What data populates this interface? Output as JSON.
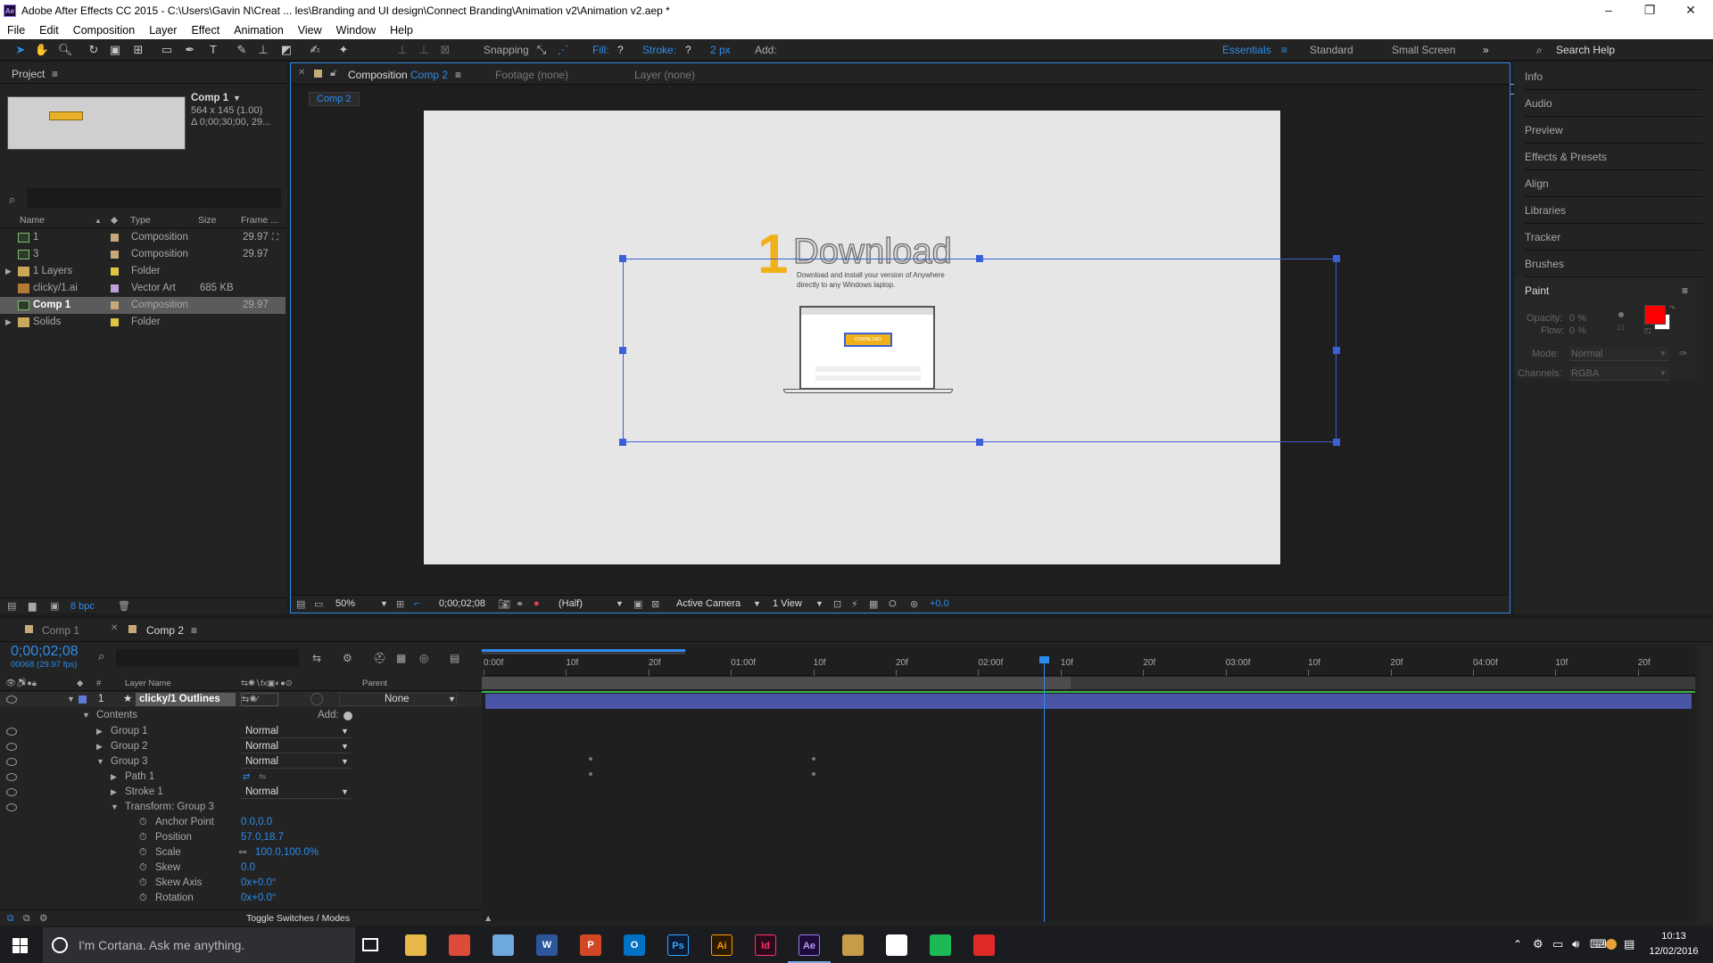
{
  "window": {
    "app_badge": "Ae",
    "title": "Adobe After Effects CC 2015 - C:\\Users\\Gavin N\\Creat ... les\\Branding and UI design\\Connect Branding\\Animation v2\\Animation v2.aep *",
    "minimize": "–",
    "maximize": "❐",
    "close": "✕"
  },
  "menu": [
    "File",
    "Edit",
    "Composition",
    "Layer",
    "Effect",
    "Animation",
    "View",
    "Window",
    "Help"
  ],
  "toolbar": {
    "snapping": "Snapping",
    "fill_label": "Fill:",
    "fill_value": "?",
    "stroke_label": "Stroke:",
    "stroke_value": "?",
    "stroke_px": "2 px",
    "add_label": "Add:",
    "workspaces": [
      "Essentials",
      "Standard",
      "Small Screen"
    ],
    "more": "»",
    "search_help": "Search Help"
  },
  "project": {
    "tab": "Project",
    "menu_icon": "≡",
    "preview_name": "Comp 1",
    "preview_dims": "564 x 145 (1.00)",
    "preview_duration": "Δ 0;00;30;00, 29...",
    "columns": [
      "Name",
      "Type",
      "Size",
      "Frame ..."
    ],
    "items": [
      {
        "name": "1",
        "type": "Composition",
        "size": "",
        "fps": "29.97",
        "color": "#c7a87a"
      },
      {
        "name": "3",
        "type": "Composition",
        "size": "",
        "fps": "29.97",
        "color": "#c7a87a"
      },
      {
        "name": "1 Layers",
        "type": "Folder",
        "size": "",
        "fps": "",
        "color": "#e0c442"
      },
      {
        "name": "clicky/1.ai",
        "type": "Vector Art",
        "size": "685 KB",
        "fps": "",
        "color": "#b9a2d8"
      },
      {
        "name": "Comp 1",
        "type": "Composition",
        "size": "",
        "fps": "29.97",
        "color": "#c7a87a"
      },
      {
        "name": "Solids",
        "type": "Folder",
        "size": "",
        "fps": "",
        "color": "#e0c442"
      }
    ],
    "bpc": "8 bpc"
  },
  "viewer": {
    "tabs": [
      {
        "label": "Composition",
        "sub": "Comp 2"
      },
      {
        "label": "Footage (none)",
        "sub": ""
      },
      {
        "label": "Layer (none)",
        "sub": ""
      }
    ],
    "breadcrumb": "Comp 2",
    "artwork": {
      "number": "1",
      "heading": "Download",
      "line1": "Download and install your version of Anywhere",
      "line2": "directly to any Windows laptop.",
      "button": "DOWNLOAD"
    },
    "footer": {
      "zoom": "50%",
      "timecode": "0;00;02;08",
      "resolution": "(Half)",
      "camera": "Active Camera",
      "views": "1 View",
      "exposure": "+0.0"
    }
  },
  "right_panels": [
    "Info",
    "Audio",
    "Preview",
    "Effects & Presets",
    "Align",
    "Libraries",
    "Tracker",
    "Brushes"
  ],
  "paint": {
    "title": "Paint",
    "opacity_label": "Opacity:",
    "opacity_value": "0 %",
    "flow_label": "Flow:",
    "flow_value": "0 %",
    "brush_size": "13",
    "mode_label": "Mode:",
    "mode_value": "Normal",
    "channels_label": "Channels:",
    "channels_value": "RGBA",
    "fg_color": "#ff0000",
    "bg_color": "#ffffff"
  },
  "timeline": {
    "tabs": [
      "Comp 1",
      "Comp 2"
    ],
    "timecode": "0;00;02;08",
    "frame_info": "00068 (29.97 fps)",
    "col_layer_name": "Layer Name",
    "col_parent": "Parent",
    "col_hash": "#",
    "ruler": [
      "0:00f",
      "10f",
      "20f",
      "01:00f",
      "10f",
      "20f",
      "02:00f",
      "10f",
      "20f",
      "03:00f",
      "10f",
      "20f",
      "04:00f",
      "10f",
      "20f"
    ],
    "layer": {
      "num": "1",
      "name": "clicky/1 Outlines",
      "parent": "None"
    },
    "contents": "Contents",
    "add": "Add:",
    "rows": [
      {
        "label": "Group 1",
        "value": "Normal",
        "indent": 1,
        "expanded": false,
        "kind": "dropdown"
      },
      {
        "label": "Group 2",
        "value": "Normal",
        "indent": 1,
        "expanded": false,
        "kind": "dropdown"
      },
      {
        "label": "Group 3",
        "value": "Normal",
        "indent": 1,
        "expanded": true,
        "kind": "dropdown"
      },
      {
        "label": "Path 1",
        "value": "",
        "indent": 2,
        "expanded": false,
        "kind": "path"
      },
      {
        "label": "Stroke 1",
        "value": "Normal",
        "indent": 2,
        "expanded": false,
        "kind": "dropdown"
      },
      {
        "label": "Transform: Group 3",
        "value": "",
        "indent": 2,
        "expanded": true,
        "kind": "none"
      },
      {
        "label": "Anchor Point",
        "value": "0.0,0.0",
        "indent": 3,
        "kind": "prop"
      },
      {
        "label": "Position",
        "value": "57.0,18.7",
        "indent": 3,
        "kind": "prop"
      },
      {
        "label": "Scale",
        "value": "100.0,100.0%",
        "indent": 3,
        "kind": "prop"
      },
      {
        "label": "Skew",
        "value": "0.0",
        "indent": 3,
        "kind": "prop"
      },
      {
        "label": "Skew Axis",
        "value": "0x+0.0°",
        "indent": 3,
        "kind": "prop"
      },
      {
        "label": "Rotation",
        "value": "0x+0.0°",
        "indent": 3,
        "kind": "prop"
      }
    ],
    "toggle": "Toggle Switches / Modes",
    "playhead_fraction": 0.463
  },
  "taskbar": {
    "cortana": "I'm Cortana. Ask me anything.",
    "apps": [
      {
        "label": "",
        "color": "#e8b84a",
        "name": "file-explorer-icon"
      },
      {
        "label": "",
        "color": "#dd4b39",
        "name": "chrome-icon"
      },
      {
        "label": "",
        "color": "#6fa8dc",
        "name": "pen-app-icon"
      },
      {
        "label": "W",
        "color": "#2b579a",
        "name": "word-icon"
      },
      {
        "label": "P",
        "color": "#d24726",
        "name": "powerpoint-icon"
      },
      {
        "label": "O",
        "color": "#0072c6",
        "name": "outlook-icon"
      },
      {
        "label": "Ps",
        "color": "#0c1a33",
        "name": "photoshop-icon"
      },
      {
        "label": "Ai",
        "color": "#2b1a00",
        "name": "illustrator-icon"
      },
      {
        "label": "Id",
        "color": "#2d0a1b",
        "name": "indesign-icon"
      },
      {
        "label": "Ae",
        "color": "#1f0b39",
        "name": "after-effects-icon"
      },
      {
        "label": "",
        "color": "#c69c4a",
        "name": "notes-app-icon"
      },
      {
        "label": "",
        "color": "#ffffff",
        "name": "slack-icon"
      },
      {
        "label": "",
        "color": "#1db954",
        "name": "spotify-icon"
      },
      {
        "label": "",
        "color": "#e02a2a",
        "name": "creative-cloud-icon"
      }
    ],
    "time": "10:13",
    "date": "12/02/2016"
  }
}
